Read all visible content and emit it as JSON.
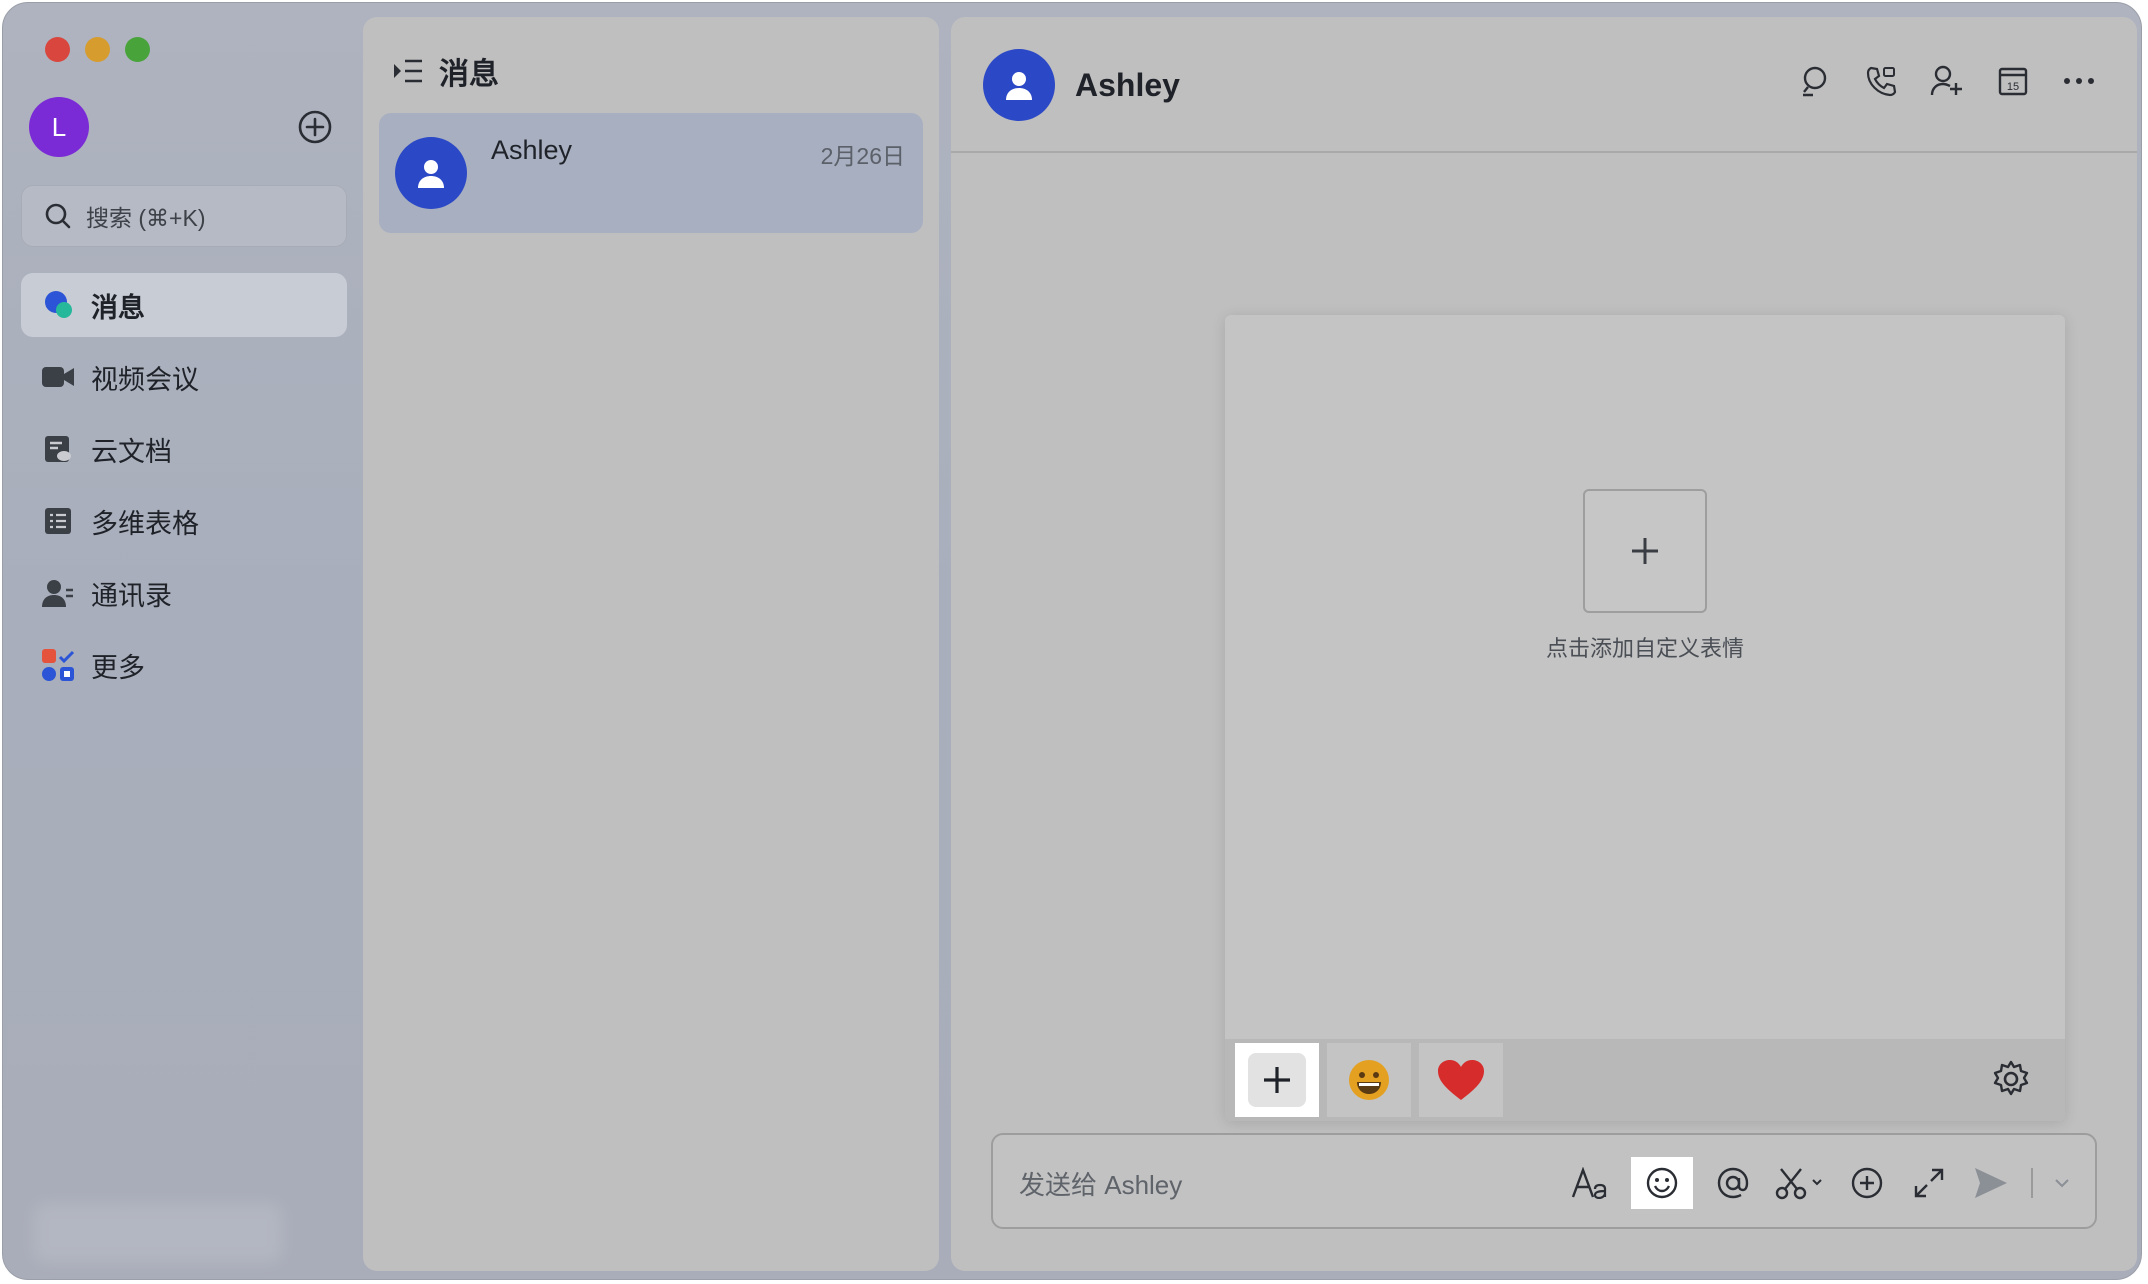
{
  "window": {
    "traffic_lights": [
      "close",
      "minimize",
      "maximize"
    ]
  },
  "sidebar": {
    "user_avatar_initial": "L",
    "search_placeholder": "搜索 (⌘+K)",
    "items": [
      {
        "label": "消息",
        "icon": "chat-bubbles-icon",
        "active": true
      },
      {
        "label": "视频会议",
        "icon": "video-camera-icon",
        "active": false
      },
      {
        "label": "云文档",
        "icon": "cloud-doc-icon",
        "active": false
      },
      {
        "label": "多维表格",
        "icon": "table-icon",
        "active": false
      },
      {
        "label": "通讯录",
        "icon": "contacts-icon",
        "active": false
      },
      {
        "label": "更多",
        "icon": "apps-grid-icon",
        "active": false
      }
    ]
  },
  "message_list": {
    "title": "消息",
    "conversations": [
      {
        "name": "Ashley",
        "date": "2月26日"
      }
    ]
  },
  "chat": {
    "title": "Ashley",
    "header_actions": [
      "search-chat-icon",
      "call-icon",
      "add-member-icon",
      "calendar-icon",
      "more-icon"
    ],
    "calendar_day": "15",
    "sticker_panel": {
      "add_label": "点击添加自定义表情"
    },
    "input": {
      "placeholder": "发送给 Ashley"
    }
  },
  "colors": {
    "avatar_user": "#7b2bd6",
    "avatar_contact": "#2b48c6",
    "heart": "#d62c2c",
    "emoji_face": "#e4a021"
  }
}
